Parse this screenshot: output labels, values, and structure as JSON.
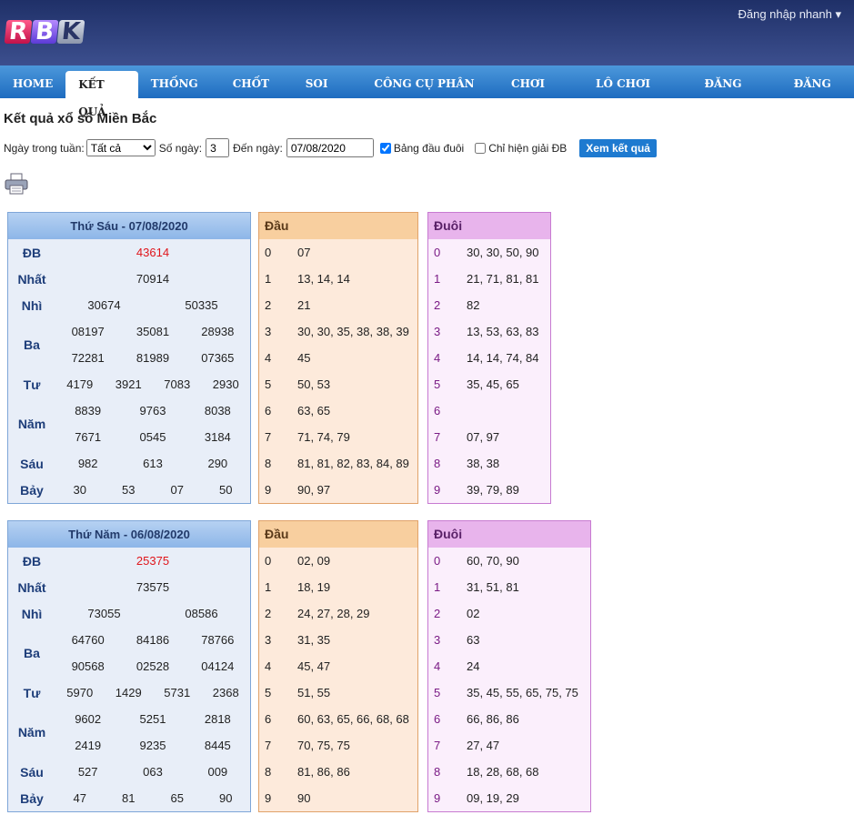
{
  "header": {
    "logo_letters": [
      "R",
      "B",
      "K"
    ],
    "login_quick": "Đăng nhập nhanh ▾"
  },
  "nav": [
    "HOME",
    "KẾT QUẢ",
    "THỐNG KÊ",
    "CHỐT SỐ",
    "SOI CẦU",
    "CÔNG CỤ PHÂN TÍCH",
    "CHƠI LOTO",
    "LÔ CHƠI NHIỀU",
    "ĐĂNG NHẬP",
    "ĐĂNG KÝ"
  ],
  "nav_active": 1,
  "page_title": "Kết quả xổ số Miền Bắc",
  "filter": {
    "weekday_label": "Ngày trong tuần:",
    "weekday_value": "Tất cả",
    "days_label": "Số ngày:",
    "days_value": "3",
    "to_label": "Đến ngày:",
    "to_value": "07/08/2020",
    "check_dauduoi": "Bảng đầu đuôi",
    "check_only_db": "Chỉ hiện giải ĐB",
    "submit": "Xem kết quả"
  },
  "icons": {
    "print": "printer-icon"
  },
  "results": [
    {
      "date": "Thứ Sáu - 07/08/2020",
      "prizes": [
        {
          "label": "ĐB",
          "rows": [
            [
              "43614"
            ]
          ]
        },
        {
          "label": "Nhất",
          "rows": [
            [
              "70914"
            ]
          ]
        },
        {
          "label": "Nhì",
          "rows": [
            [
              "30674",
              "50335"
            ]
          ]
        },
        {
          "label": "Ba",
          "rows": [
            [
              "08197",
              "35081",
              "28938"
            ],
            [
              "72281",
              "81989",
              "07365"
            ]
          ]
        },
        {
          "label": "Tư",
          "rows": [
            [
              "4179",
              "3921",
              "7083",
              "2930"
            ]
          ]
        },
        {
          "label": "Năm",
          "rows": [
            [
              "8839",
              "9763",
              "8038"
            ],
            [
              "7671",
              "0545",
              "3184"
            ]
          ]
        },
        {
          "label": "Sáu",
          "rows": [
            [
              "982",
              "613",
              "290"
            ]
          ]
        },
        {
          "label": "Bảy",
          "rows": [
            [
              "30",
              "53",
              "07",
              "50"
            ]
          ]
        }
      ],
      "dau_title": "Đầu",
      "dau": [
        "07",
        "13, 14, 14",
        "21",
        "30, 30, 35, 38, 38, 39",
        "45",
        "50, 53",
        "63, 65",
        "71, 74, 79",
        "81, 81, 82, 83, 84, 89",
        "90, 97"
      ],
      "duoi_title": "Đuôi",
      "duoi": [
        "30, 30, 50, 90",
        "21, 71, 81, 81",
        "82",
        "13, 53, 63, 83",
        "14, 14, 74, 84",
        "35, 45, 65",
        "",
        "07, 97",
        "38, 38",
        "39, 79, 89"
      ]
    },
    {
      "date": "Thứ Năm - 06/08/2020",
      "prizes": [
        {
          "label": "ĐB",
          "rows": [
            [
              "25375"
            ]
          ]
        },
        {
          "label": "Nhất",
          "rows": [
            [
              "73575"
            ]
          ]
        },
        {
          "label": "Nhì",
          "rows": [
            [
              "73055",
              "08586"
            ]
          ]
        },
        {
          "label": "Ba",
          "rows": [
            [
              "64760",
              "84186",
              "78766"
            ],
            [
              "90568",
              "02528",
              "04124"
            ]
          ]
        },
        {
          "label": "Tư",
          "rows": [
            [
              "5970",
              "1429",
              "5731",
              "2368"
            ]
          ]
        },
        {
          "label": "Năm",
          "rows": [
            [
              "9602",
              "5251",
              "2818"
            ],
            [
              "2419",
              "9235",
              "8445"
            ]
          ]
        },
        {
          "label": "Sáu",
          "rows": [
            [
              "527",
              "063",
              "009"
            ]
          ]
        },
        {
          "label": "Bảy",
          "rows": [
            [
              "47",
              "81",
              "65",
              "90"
            ]
          ]
        }
      ],
      "dau_title": "Đầu",
      "dau": [
        "02, 09",
        "18, 19",
        "24, 27, 28, 29",
        "31, 35",
        "45, 47",
        "51, 55",
        "60, 63, 65, 66, 68, 68",
        "70, 75, 75",
        "81, 86, 86",
        "90"
      ],
      "duoi_title": "Đuôi",
      "duoi": [
        "60, 70, 90",
        "31, 51, 81",
        "02",
        "63",
        "24",
        "35, 45, 55, 65, 75, 75",
        "66, 86, 86",
        "27, 47",
        "18, 28, 68, 68",
        "09, 19, 29"
      ]
    }
  ]
}
